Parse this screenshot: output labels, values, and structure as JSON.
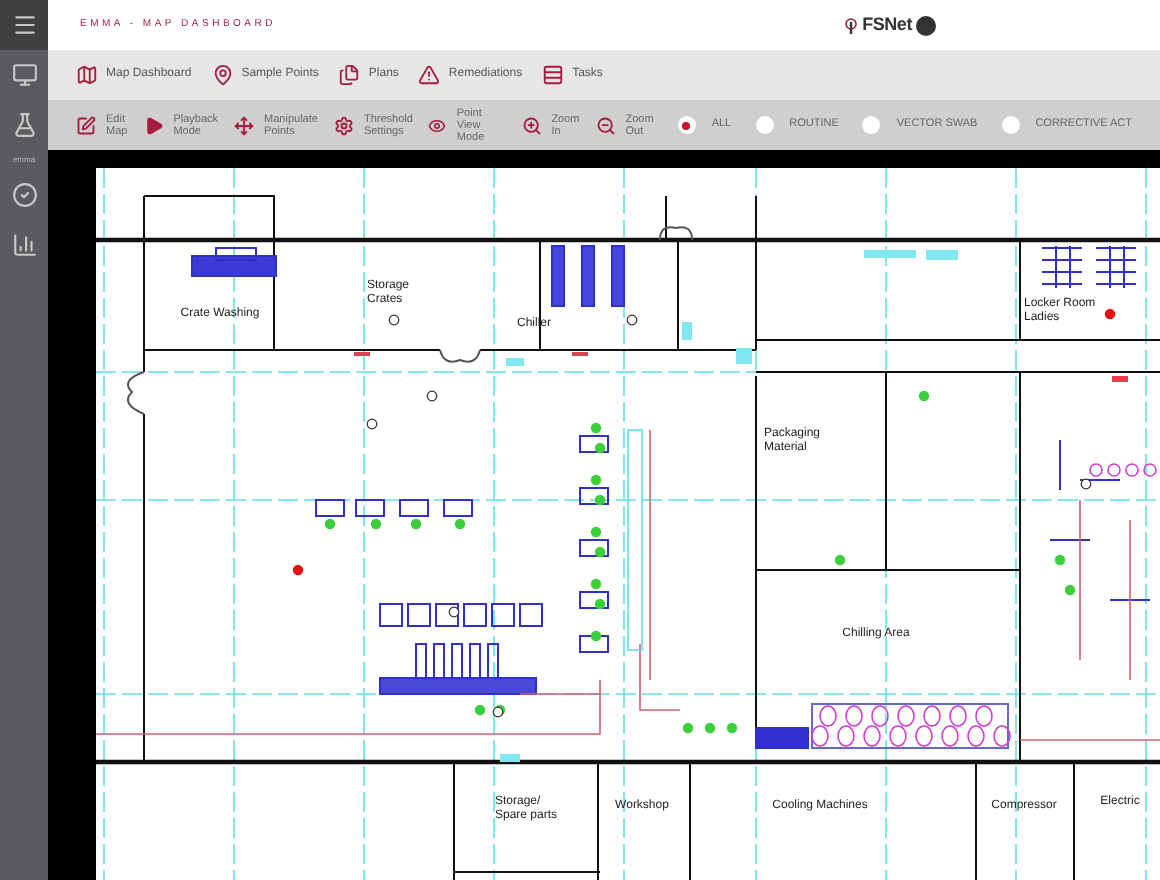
{
  "app_title": "EMMA - MAP DASHBOARD",
  "logo": {
    "text": "FSNet"
  },
  "sidebar": {
    "items": [
      {
        "kind": "menu",
        "selected": true
      },
      {
        "kind": "monitor",
        "selected": false
      },
      {
        "kind": "flask",
        "selected": false
      },
      {
        "kind": "text",
        "label": "emma",
        "selected": false
      },
      {
        "kind": "check",
        "selected": false
      },
      {
        "kind": "chart",
        "selected": false
      }
    ]
  },
  "nav": [
    {
      "kind": "map",
      "label": "Map Dashboard"
    },
    {
      "kind": "pin",
      "label": "Sample Points"
    },
    {
      "kind": "files",
      "label": "Plans"
    },
    {
      "kind": "alert",
      "label": "Remediations"
    },
    {
      "kind": "list",
      "label": "Tasks"
    }
  ],
  "toolbar": [
    {
      "kind": "edit",
      "label": "Edit\nMap"
    },
    {
      "kind": "play",
      "label": "Playback\nMode"
    },
    {
      "kind": "move",
      "label": "Manipulate\nPoints"
    },
    {
      "kind": "gear",
      "label": "Threshold\nSettings"
    },
    {
      "kind": "eye",
      "label": "Point\nView Mode"
    },
    {
      "kind": "zoom-in",
      "label": "Zoom\nIn"
    },
    {
      "kind": "zoom-out",
      "label": "Zoom\nOut"
    }
  ],
  "filters": [
    {
      "label": "ALL",
      "selected": true
    },
    {
      "label": "ROUTINE",
      "selected": false
    },
    {
      "label": "VECTOR SWAB",
      "selected": false
    },
    {
      "label": "CORRECTIVE ACT",
      "selected": false
    }
  ],
  "map": {
    "rooms": [
      {
        "label": "Crate Washing"
      },
      {
        "label": "Storage\nCrates"
      },
      {
        "label": "Chiller"
      },
      {
        "label": "Locker Room\nLadies"
      },
      {
        "label": "Packaging\nMaterial"
      },
      {
        "label": "Chilling Area"
      },
      {
        "label": "Storage/\nSpare parts"
      },
      {
        "label": "Workshop"
      },
      {
        "label": "Cooling Machines"
      },
      {
        "label": "Compressor"
      },
      {
        "label": "Electric"
      }
    ]
  }
}
